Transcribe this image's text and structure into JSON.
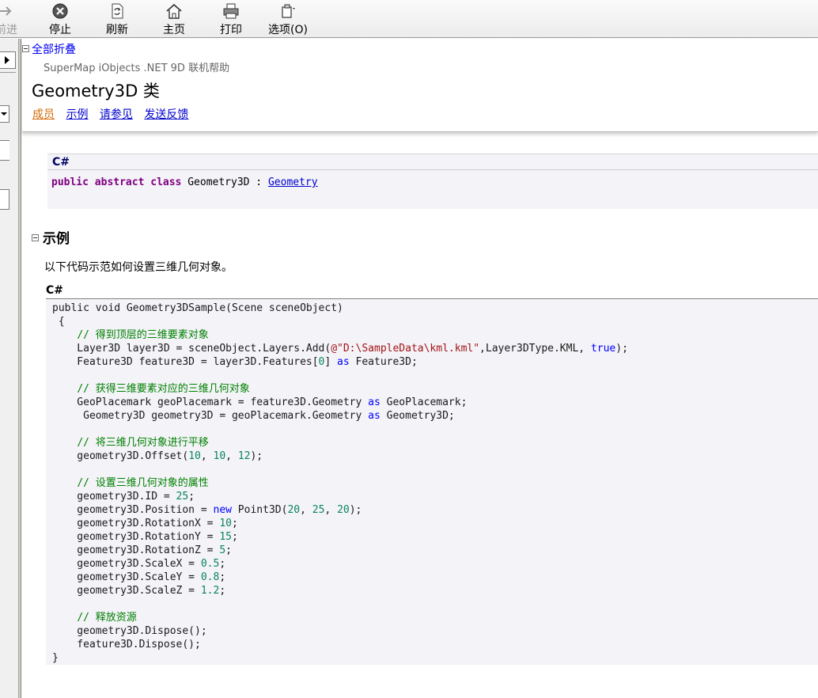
{
  "toolbar": {
    "forward": "前进",
    "stop": "停止",
    "refresh": "刷新",
    "home": "主页",
    "print": "打印",
    "options": "选项(O)"
  },
  "header": {
    "collapse_all": "全部折叠",
    "product": "SuperMap iObjects .NET 9D 联机帮助",
    "title": "Geometry3D 类",
    "links": [
      "成员",
      "示例",
      "请参见",
      "发送反馈"
    ]
  },
  "syntax": {
    "lang": "C#",
    "kw_public": "public",
    "kw_abstract": "abstract",
    "kw_class": "class",
    "class_name": " Geometry3D : ",
    "base_class": "Geometry"
  },
  "example": {
    "heading": "示例",
    "description": "以下代码示范如何设置三维几何对象。",
    "lang": "C#",
    "code": [
      [
        [
          "t",
          "public void Geometry3DSample(Scene sceneObject)"
        ]
      ],
      [
        [
          "t",
          " {"
        ]
      ],
      [
        [
          "t",
          "    "
        ],
        [
          "cm",
          "// 得到顶层的三维要素对象"
        ]
      ],
      [
        [
          "t",
          "    Layer3D layer3D = sceneObject.Layers.Add("
        ],
        [
          "str",
          "@\"D:\\SampleData\\kml.kml\""
        ],
        [
          "t",
          ",Layer3DType.KML, "
        ],
        [
          "kw",
          "true"
        ],
        [
          "t",
          ");"
        ]
      ],
      [
        [
          "t",
          "    Feature3D feature3D = layer3D.Features["
        ],
        [
          "num",
          "0"
        ],
        [
          "t",
          "] "
        ],
        [
          "kw",
          "as"
        ],
        [
          "t",
          " Feature3D;"
        ]
      ],
      [
        [
          "t",
          ""
        ]
      ],
      [
        [
          "t",
          "    "
        ],
        [
          "cm",
          "// 获得三维要素对应的三维几何对象"
        ]
      ],
      [
        [
          "t",
          "    GeoPlacemark geoPlacemark = feature3D.Geometry "
        ],
        [
          "kw",
          "as"
        ],
        [
          "t",
          " GeoPlacemark;"
        ]
      ],
      [
        [
          "t",
          "     Geometry3D geometry3D = geoPlacemark.Geometry "
        ],
        [
          "kw",
          "as"
        ],
        [
          "t",
          " Geometry3D;"
        ]
      ],
      [
        [
          "t",
          ""
        ]
      ],
      [
        [
          "t",
          "    "
        ],
        [
          "cm",
          "// 将三维几何对象进行平移"
        ]
      ],
      [
        [
          "t",
          "    geometry3D.Offset("
        ],
        [
          "num",
          "10"
        ],
        [
          "t",
          ", "
        ],
        [
          "num",
          "10"
        ],
        [
          "t",
          ", "
        ],
        [
          "num",
          "12"
        ],
        [
          "t",
          ");"
        ]
      ],
      [
        [
          "t",
          ""
        ]
      ],
      [
        [
          "t",
          "    "
        ],
        [
          "cm",
          "// 设置三维几何对象的属性"
        ]
      ],
      [
        [
          "t",
          "    geometry3D.ID = "
        ],
        [
          "num",
          "25"
        ],
        [
          "t",
          ";"
        ]
      ],
      [
        [
          "t",
          "    geometry3D.Position = "
        ],
        [
          "kw",
          "new"
        ],
        [
          "t",
          " Point3D("
        ],
        [
          "num",
          "20"
        ],
        [
          "t",
          ", "
        ],
        [
          "num",
          "25"
        ],
        [
          "t",
          ", "
        ],
        [
          "num",
          "20"
        ],
        [
          "t",
          ");"
        ]
      ],
      [
        [
          "t",
          "    geometry3D.RotationX = "
        ],
        [
          "num",
          "10"
        ],
        [
          "t",
          ";"
        ]
      ],
      [
        [
          "t",
          "    geometry3D.RotationY = "
        ],
        [
          "num",
          "15"
        ],
        [
          "t",
          ";"
        ]
      ],
      [
        [
          "t",
          "    geometry3D.RotationZ = "
        ],
        [
          "num",
          "5"
        ],
        [
          "t",
          ";"
        ]
      ],
      [
        [
          "t",
          "    geometry3D.ScaleX = "
        ],
        [
          "num",
          "0.5"
        ],
        [
          "t",
          ";"
        ]
      ],
      [
        [
          "t",
          "    geometry3D.ScaleY = "
        ],
        [
          "num",
          "0.8"
        ],
        [
          "t",
          ";"
        ]
      ],
      [
        [
          "t",
          "    geometry3D.ScaleZ = "
        ],
        [
          "num",
          "1.2"
        ],
        [
          "t",
          ";"
        ]
      ],
      [
        [
          "t",
          ""
        ]
      ],
      [
        [
          "t",
          "    "
        ],
        [
          "cm",
          "// 释放资源"
        ]
      ],
      [
        [
          "t",
          "    geometry3D.Dispose();"
        ]
      ],
      [
        [
          "t",
          "    feature3D.Dispose();"
        ]
      ],
      [
        [
          "t",
          "}"
        ]
      ]
    ]
  }
}
